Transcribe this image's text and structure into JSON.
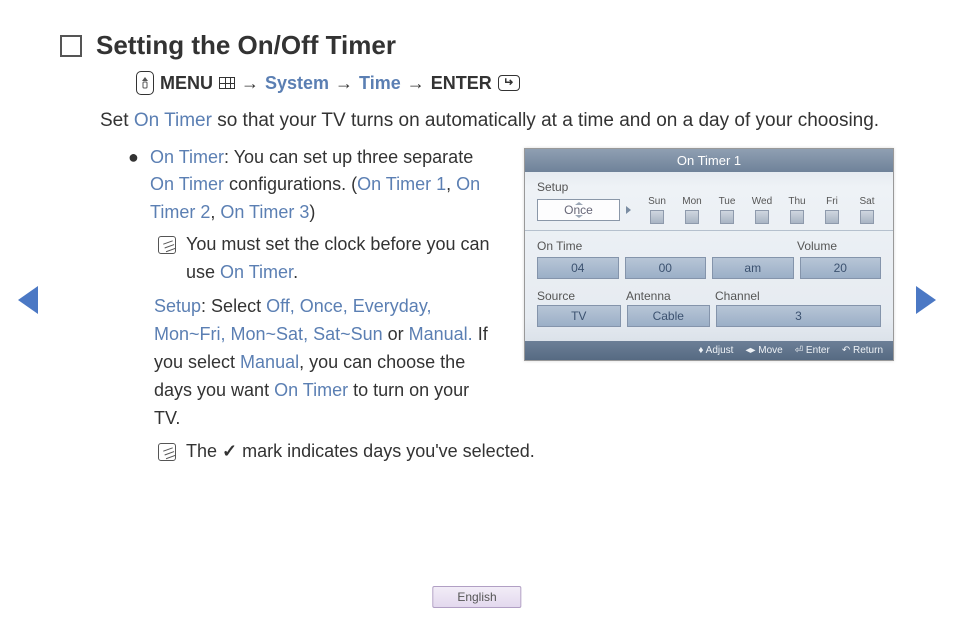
{
  "title": "Setting the On/Off Timer",
  "nav": {
    "menu_label": "MENU",
    "crumb1": "System",
    "crumb2": "Time",
    "enter_label": "ENTER",
    "arrow": "→"
  },
  "intro": {
    "pre": "Set ",
    "link": "On Timer",
    "post": " so that your TV turns on automatically at a time and on a day of your choosing."
  },
  "bullet": {
    "title": "On Timer",
    "text1": ": You can set up three separate ",
    "link1": "On Timer",
    "text2": " configurations. (",
    "t1": "On Timer 1",
    "comma1": ", ",
    "t2": "On Timer 2",
    "comma2": ", ",
    "t3": "On Timer 3",
    "close": ")"
  },
  "note1": {
    "a": "You must set the clock before you can use ",
    "link": "On Timer",
    "b": "."
  },
  "setup_para": {
    "setup": "Setup",
    "a": ": Select ",
    "opts": "Off, Once, Everyday, Mon~Fri, Mon~Sat, Sat~Sun",
    "b": " or ",
    "manual": "Manual.",
    "c": " If you select ",
    "manual2": "Manual",
    "d": ", you can choose the days you want ",
    "ontimer": "On Timer",
    "e": " to turn on your TV."
  },
  "note2": {
    "a": "The ",
    "b": " mark indicates days you've selected."
  },
  "panel": {
    "title": "On Timer 1",
    "setup_label": "Setup",
    "setup_value": "Once",
    "days": [
      "Sun",
      "Mon",
      "Tue",
      "Wed",
      "Thu",
      "Fri",
      "Sat"
    ],
    "ontime_label": "On Time",
    "volume_label": "Volume",
    "hour": "04",
    "minute": "00",
    "ampm": "am",
    "volume": "20",
    "source_label": "Source",
    "antenna_label": "Antenna",
    "channel_label": "Channel",
    "source": "TV",
    "antenna": "Cable",
    "channel": "3",
    "footer_adjust": "Adjust",
    "footer_move": "Move",
    "footer_enter": "Enter",
    "footer_return": "Return"
  },
  "language": "English",
  "checkmark": "✓"
}
